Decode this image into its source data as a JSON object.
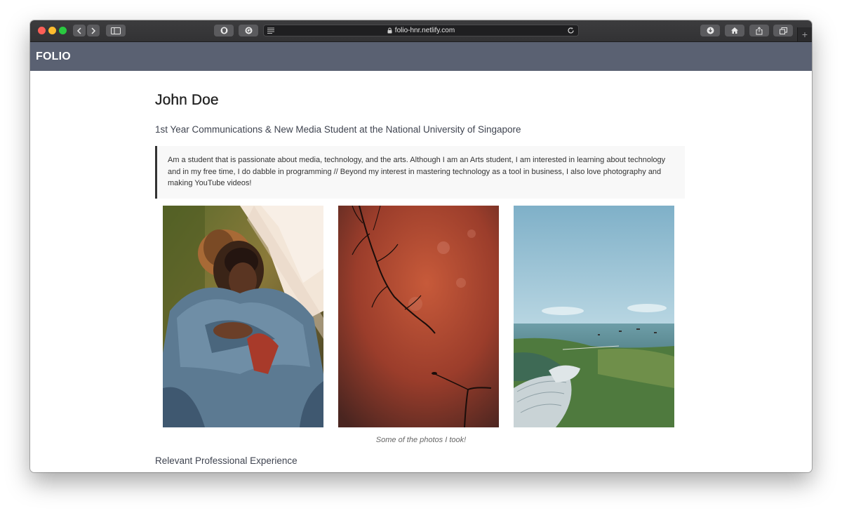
{
  "browser": {
    "url": "folio-hnr.netlify.com",
    "new_tab_label": "+"
  },
  "navbar": {
    "brand": "FOLIO"
  },
  "profile": {
    "name": "John Doe",
    "subtitle": "1st Year Communications & New Media Student at the National University of Singapore",
    "bio": "Am a student that is passionate about media, technology, and the arts. Although I am an Arts student, I am interested in learning about technology and in my free time, I do dabble in programming // Beyond my interest in mastering technology as a tool in business, I also love photography and making YouTube videos!"
  },
  "gallery": {
    "caption": "Some of the photos I took!",
    "photos": [
      {
        "subject": "couple-in-denim-portrait"
      },
      {
        "subject": "tree-branch-against-red-sky"
      },
      {
        "subject": "singapore-bay-aerial-view"
      }
    ]
  },
  "sections": {
    "experience_heading": "Relevant Professional Experience"
  },
  "colors": {
    "navbar": "#5a6172",
    "toolbar": "#3a3a3c",
    "quote_background": "#f8f8f8",
    "quote_border": "#333333"
  }
}
